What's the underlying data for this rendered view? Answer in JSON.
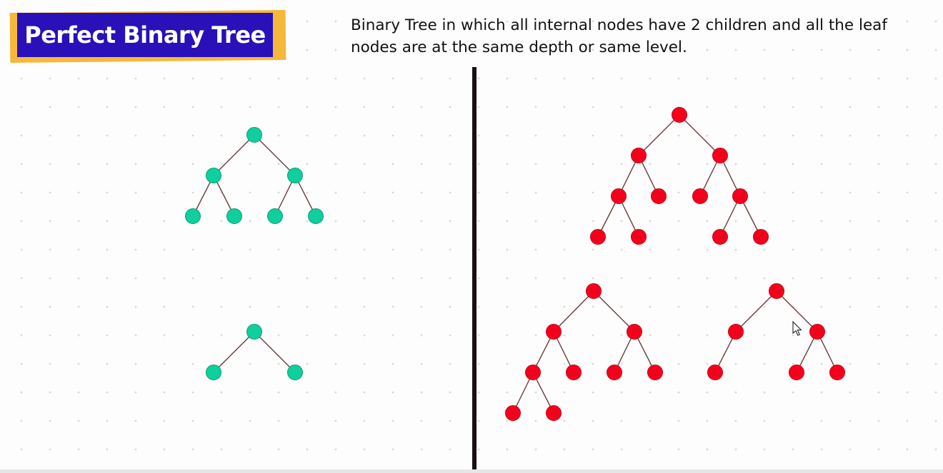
{
  "title": "Perfect Binary Tree",
  "description": "Binary Tree in which all internal nodes have 2 children and all the leaf nodes are at the same depth or same level.",
  "colors": {
    "title_background": "#2a10b8",
    "title_accent": "#f6b83a",
    "perfect_tree_nodes": "#0fcf9c",
    "counter_example_nodes": "#f5001c",
    "divider": "#1a1013"
  },
  "icons": [
    "mouse-cursor-icon"
  ]
}
